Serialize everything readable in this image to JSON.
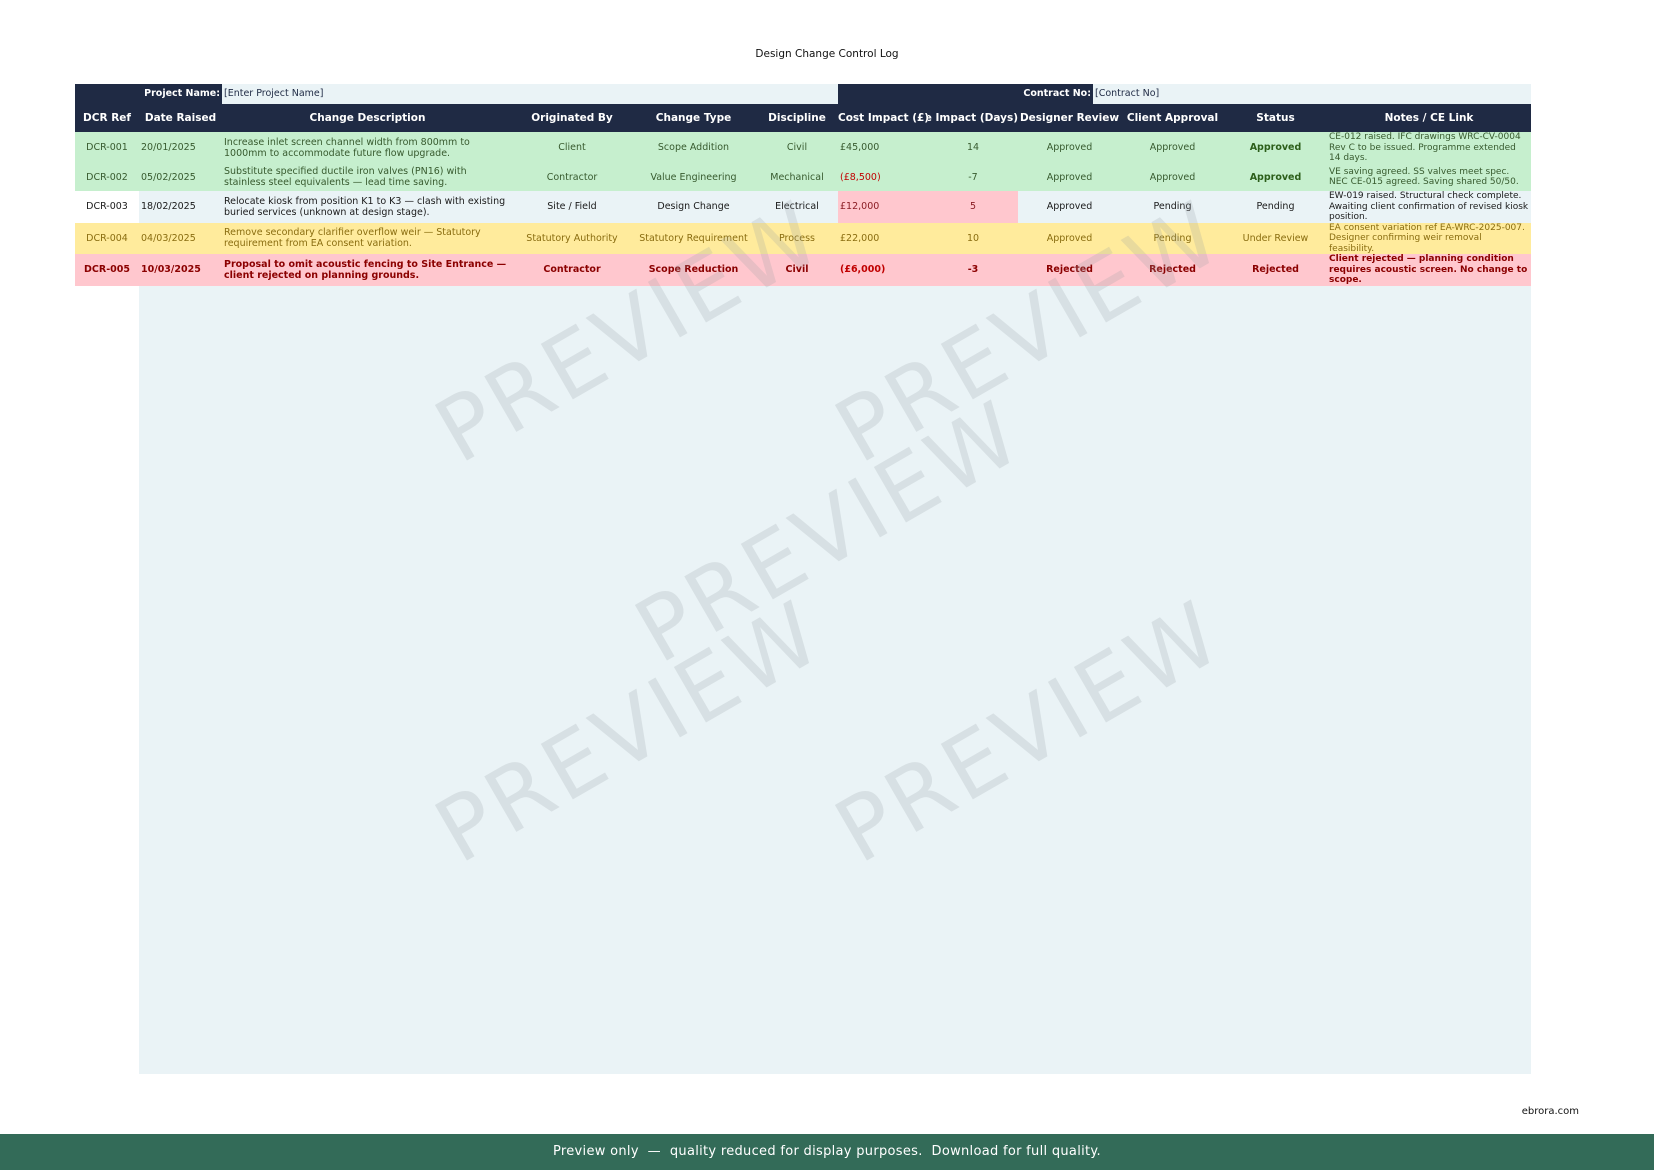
{
  "document": {
    "title": "Design Change Control Log",
    "project_label": "Project Name:",
    "project_value": "[Enter Project Name]",
    "contract_label": "Contract No:",
    "contract_value": "[Contract No]"
  },
  "table": {
    "headers": [
      "DCR Ref",
      "Date Raised",
      "Change Description",
      "Originated By",
      "Change Type",
      "Discipline",
      "Cost Impact (£)",
      "Time Impact (Days)",
      "Designer Review",
      "Client Approval",
      "Status",
      "Notes / CE Link"
    ],
    "rows": [
      {
        "style": "green",
        "ref": "DCR-001",
        "date": "20/01/2025",
        "description": "Increase inlet screen channel width from 800mm to 1000mm to accommodate future flow upgrade.",
        "originated_by": "Client",
        "change_type": "Scope Addition",
        "discipline": "Civil",
        "cost": "£45,000",
        "time": "14",
        "designer_review": "Approved",
        "client_approval": "Approved",
        "status": "Approved",
        "notes": "CE-012 raised. IFC drawings WRC-CV-0004 Rev C to be issued. Programme extended 14 days."
      },
      {
        "style": "green",
        "ref": "DCR-002",
        "date": "05/02/2025",
        "description": "Substitute specified ductile iron valves (PN16) with stainless steel equivalents — lead time saving.",
        "originated_by": "Contractor",
        "change_type": "Value Engineering",
        "discipline": "Mechanical",
        "cost": "(£8,500)",
        "time": "-7",
        "designer_review": "Approved",
        "client_approval": "Approved",
        "status": "Approved",
        "notes": "VE saving agreed. SS valves meet spec. NEC CE-015 agreed. Saving shared 50/50."
      },
      {
        "style": "white",
        "ref": "DCR-003",
        "date": "18/02/2025",
        "description": "Relocate kiosk from position K1 to K3 — clash with existing buried services (unknown at design stage).",
        "originated_by": "Site / Field",
        "change_type": "Design Change",
        "discipline": "Electrical",
        "cost": "£12,000",
        "time": "5",
        "designer_review": "Approved",
        "client_approval": "Pending",
        "status": "Pending",
        "notes": "EW-019 raised. Structural check complete. Awaiting client confirmation of revised kiosk position."
      },
      {
        "style": "yellow",
        "ref": "DCR-004",
        "date": "04/03/2025",
        "description": "Remove secondary clarifier overflow weir — Statutory requirement from EA consent variation.",
        "originated_by": "Statutory Authority",
        "change_type": "Statutory Requirement",
        "discipline": "Process",
        "cost": "£22,000",
        "time": "10",
        "designer_review": "Approved",
        "client_approval": "Pending",
        "status": "Under Review",
        "notes": "EA consent variation ref EA-WRC-2025-007. Designer confirming weir removal feasibility."
      },
      {
        "style": "red",
        "ref": "DCR-005",
        "date": "10/03/2025",
        "description": "Proposal to omit acoustic fencing to Site Entrance — client rejected on planning grounds.",
        "originated_by": "Contractor",
        "change_type": "Scope Reduction",
        "discipline": "Civil",
        "cost": "(£6,000)",
        "time": "-3",
        "designer_review": "Rejected",
        "client_approval": "Rejected",
        "status": "Rejected",
        "notes": "Client rejected — planning condition requires acoustic screen. No change to scope."
      }
    ]
  },
  "watermark": "PREVIEW",
  "site": "ebrora.com",
  "footer": "Preview only  —  quality reduced for display purposes.  Download for full quality.",
  "colors": {
    "header_navy": "#1f2a44",
    "approved_green": "#c6efce",
    "pending_yellow": "#ffeb9c",
    "rejected_pink": "#ffc7ce",
    "sheet_bg": "#eaf3f6",
    "footer_green": "#336b58"
  }
}
